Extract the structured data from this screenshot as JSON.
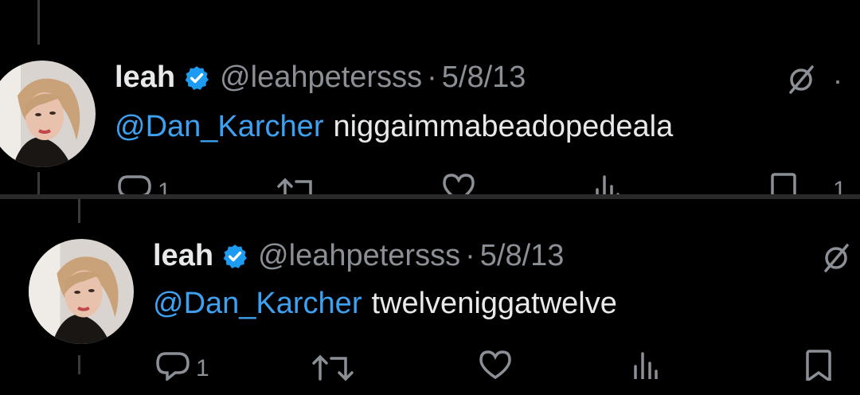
{
  "tweets": [
    {
      "author_name": "leah",
      "author_handle": "@leahpetersss",
      "separator": "·",
      "date": "5/8/13",
      "mention": "@Dan_Karcher",
      "text": "niggaimmabeadopedeala",
      "reply_count": "1",
      "more_label": "·",
      "share_count": "1"
    },
    {
      "author_name": "leah",
      "author_handle": "@leahpetersss",
      "separator": "·",
      "date": "5/8/13",
      "mention": "@Dan_Karcher",
      "text": "twelveniggatwelve",
      "reply_count": "1"
    }
  ],
  "theme": {
    "background": "#000000",
    "accent_blue": "#1d9bf0",
    "mention_color": "#3ea0ef",
    "muted_text": "#8b9096",
    "primary_text": "#e7e9ea"
  },
  "icons": [
    "verified-badge-icon",
    "grok-icon",
    "reply-icon",
    "retweet-icon",
    "like-icon",
    "views-icon",
    "bookmark-icon"
  ]
}
